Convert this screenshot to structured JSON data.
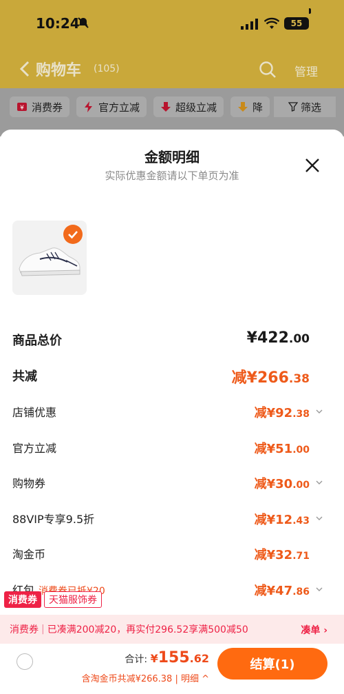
{
  "status_bar": {
    "time": "10:24",
    "battery": "55"
  },
  "nav": {
    "title": "购物车",
    "count": "(105)",
    "manage": "管理"
  },
  "chips": [
    {
      "label": "消费券",
      "icon": "coupon-icon"
    },
    {
      "label": "官方立减",
      "icon": "lightning-icon"
    },
    {
      "label": "超级立减",
      "icon": "down-arrow-icon"
    },
    {
      "label": "降",
      "icon": "down-arrow-icon"
    }
  ],
  "filter": {
    "label": "筛选"
  },
  "sheet": {
    "title": "金额明细",
    "subtitle": "实际优惠金额请以下单页为准"
  },
  "rows": [
    {
      "label": "商品总价",
      "int": "¥422",
      "dec": ".00"
    },
    {
      "label": "共减",
      "int": "减¥266",
      "dec": ".38"
    },
    {
      "label": "店铺优惠",
      "int": "减¥92",
      "dec": ".38"
    },
    {
      "label": "官方立减",
      "int": "减¥51",
      "dec": ".00"
    },
    {
      "label": "购物券",
      "int": "减¥30",
      "dec": ".00"
    },
    {
      "label": "88VIP专享9.5折",
      "int": "减¥12",
      "dec": ".43"
    },
    {
      "label": "淘金币",
      "int": "减¥32",
      "dec": ".71"
    },
    {
      "label": "红包",
      "note": "消费券已抵¥20",
      "int": "减¥47",
      "dec": ".86"
    }
  ],
  "tags": {
    "solid": "消费券",
    "outline": "天猫服饰券"
  },
  "promo": {
    "tag": "消费券",
    "text": "已凑满200减20，再实付296.52享满500减50",
    "action": "凑单 ›"
  },
  "bottom": {
    "total_label": "合计:",
    "total_currency": "¥",
    "total_int": "155",
    "total_dec": ".62",
    "detail": "含淘金币共减¥266.38 | 明细 ^",
    "checkout": "结算(1)"
  },
  "colors": {
    "accent": "#ee5a1a",
    "checkout": "#ff6a10",
    "coupon_red": "#ee2246"
  }
}
